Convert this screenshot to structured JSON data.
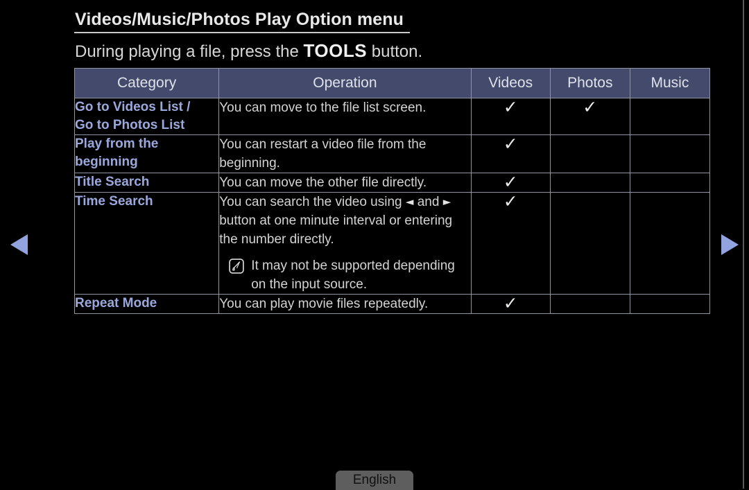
{
  "page": {
    "title": "Videos/Music/Photos Play Option menu",
    "subtitle_before": "During playing a file, press the ",
    "subtitle_emphasis": "TOOLS",
    "subtitle_after": " button.",
    "language_label": "English"
  },
  "colors": {
    "background": "#000000",
    "header_row_bg": "#434a6b",
    "category_text": "#9ba8dc",
    "body_text": "#d3d3d3",
    "border": "#8f96a3",
    "nav_arrow": "#93a3e0",
    "language_button_bg": "#5e5e5e"
  },
  "table": {
    "headers": [
      "Category",
      "Operation",
      "Videos",
      "Photos",
      "Music"
    ],
    "rows": [
      {
        "category": "Go to Videos List /\nGo to Photos List",
        "operation": "You can move to the file list screen.",
        "videos": "✓",
        "photos": "✓",
        "music": ""
      },
      {
        "category": "Play from the\nbeginning",
        "operation": "You can restart a video file from the beginning.",
        "videos": "✓",
        "photos": "",
        "music": ""
      },
      {
        "category": "Title Search",
        "operation": "You can move the other file directly.",
        "videos": "✓",
        "photos": "",
        "music": ""
      },
      {
        "category": "Time Search",
        "operation_part1": "You can search the video using ",
        "operation_arrow_left": "◄",
        "operation_part2": " and ",
        "operation_arrow_right": "►",
        "operation_part3": " button at one minute interval or entering the number directly.",
        "note": "It may not be supported depending on the input source.",
        "note_icon": "note-pencil-icon",
        "videos": "✓",
        "photos": "",
        "music": ""
      },
      {
        "category": "Repeat Mode",
        "operation": "You can play movie files repeatedly.",
        "videos": "✓",
        "photos": "",
        "music": ""
      }
    ]
  },
  "navigation": {
    "prev_icon": "triangle-left-icon",
    "next_icon": "triangle-right-icon"
  }
}
